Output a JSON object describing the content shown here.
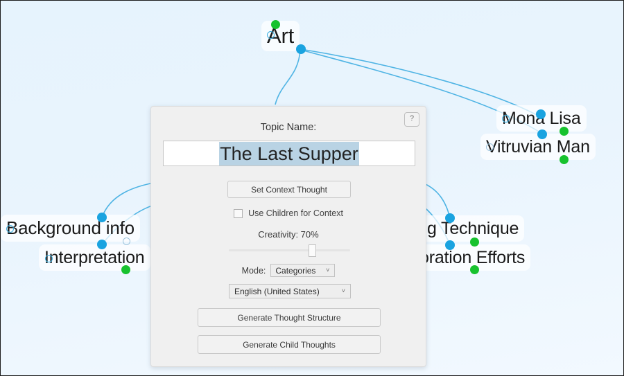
{
  "canvas": {
    "background_color": "#e8f4fd",
    "edge_color": "#4fb4e4",
    "node_dot_blue": "#1aa3e0",
    "node_dot_green": "#17c22e"
  },
  "mindmap": {
    "nodes": [
      {
        "id": "art",
        "label": "Art"
      },
      {
        "id": "mona-lisa",
        "label": "Mona Lisa"
      },
      {
        "id": "vitruvian-man",
        "label": "Vitruvian Man"
      },
      {
        "id": "background-info",
        "label": "Background info"
      },
      {
        "id": "interpretation",
        "label": "Interpretation"
      },
      {
        "id": "painting-technique",
        "label": "ing Technique"
      },
      {
        "id": "restoration-efforts",
        "label": "oration Efforts"
      }
    ]
  },
  "dialog": {
    "help_button_label": "?",
    "topic_name_label": "Topic Name:",
    "topic_name_value": "The Last Supper",
    "topic_name_placeholder": "Topic Name",
    "set_context_button": "Set Context Thought",
    "use_children_checkbox_label": "Use Children for Context",
    "use_children_checked": false,
    "creativity_label": "Creativity: 70%",
    "creativity_value": 70,
    "mode_label": "Mode:",
    "mode_value": "Categories",
    "language_value": "English (United States)",
    "generate_structure_button": "Generate Thought Structure",
    "generate_children_button": "Generate Child Thoughts",
    "caret_glyph": "˅"
  }
}
